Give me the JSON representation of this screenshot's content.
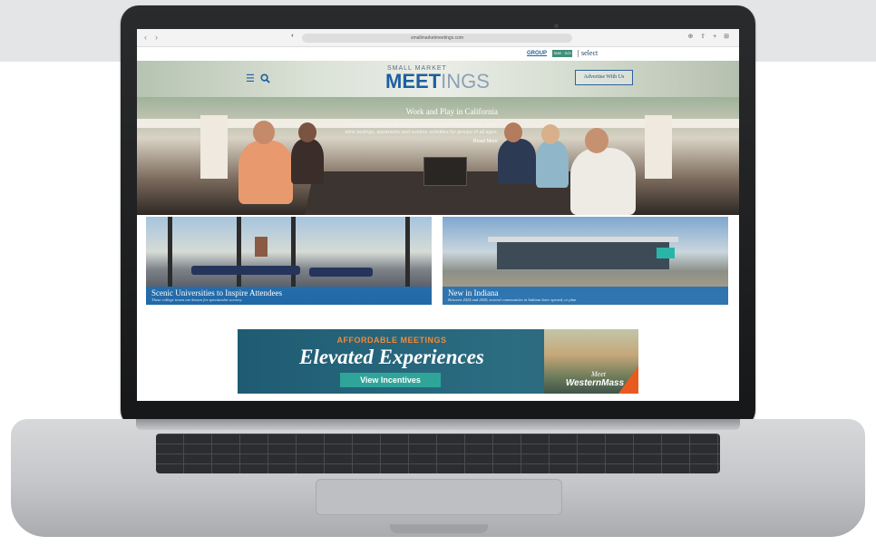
{
  "browser": {
    "url": "smallmarketmeetings.com",
    "back_icon": "chevron-left-icon",
    "forward_icon": "chevron-right-icon",
    "toolbar_icons": "⊕ ⇧ + ⊞"
  },
  "group_bar": {
    "group_label": "GROUP",
    "partner_label": "SME · SOI",
    "select_label": "select"
  },
  "header": {
    "logo_small": "SMALL MARKET",
    "logo_meet": "MEET",
    "logo_ings": "INGS",
    "advertise_label": "Advertise With Us",
    "menu_icon": "menu-icon",
    "search_icon": "search-icon"
  },
  "hero": {
    "title": "Work and Play in California",
    "description": "These classic California leisure destinations offer theme parks, tours, wine tastings, aquariums and outdoor activities for groups of all ages.",
    "read_more": "Read More"
  },
  "cards": [
    {
      "title": "Scenic Universities to Inspire Attendees",
      "subtitle": "These college towns are known for spectacular scenery."
    },
    {
      "title": "New in Indiana",
      "subtitle": "Between 2024 and 2026, several communities in Indiana have opened, or plan"
    }
  ],
  "ad": {
    "kicker": "AFFORDABLE MEETINGS",
    "headline": "Elevated Experiences",
    "button": "View Incentives",
    "brand_line1": "Meet",
    "brand_line2": "WesternMass"
  },
  "colors": {
    "brand_blue": "#1d5fa0",
    "caption_blue": "#1e6eb4",
    "ad_teal": "#1f5c73",
    "ad_orange": "#f08a3b",
    "button_teal": "#2fa59a"
  }
}
